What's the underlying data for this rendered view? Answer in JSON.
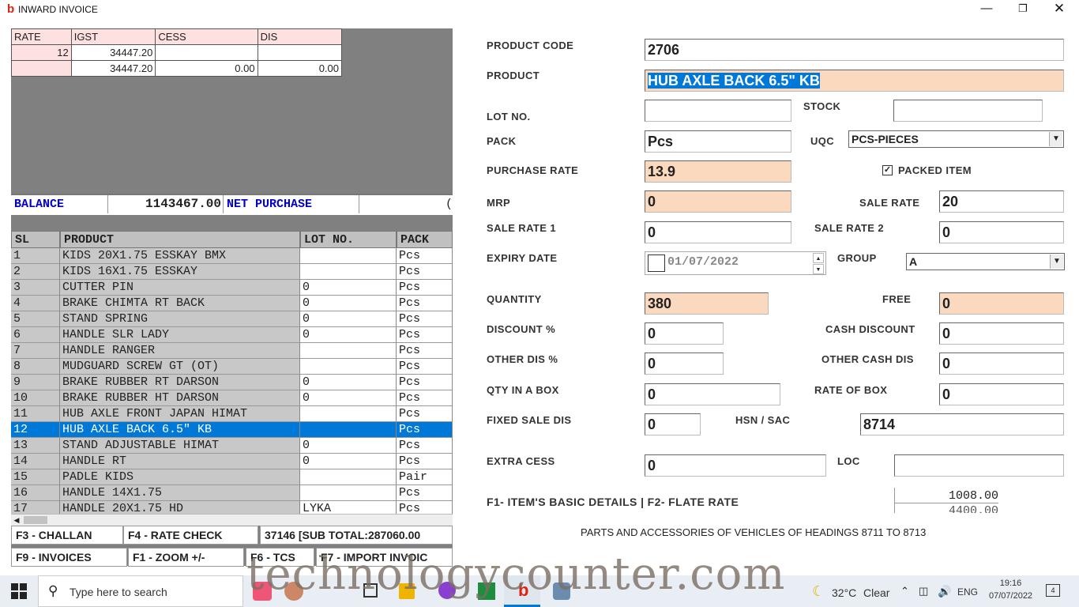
{
  "window": {
    "title": "INWARD INVOICE",
    "app_icon": "b",
    "min_icon": "minimize-icon",
    "max_icon": "maximize-icon",
    "close_icon": "close-icon"
  },
  "summary": {
    "headers": [
      "RATE",
      "IGST",
      "CESS",
      "DIS"
    ],
    "rows": [
      [
        "12",
        "34447.20",
        "",
        ""
      ],
      [
        "",
        "34447.20",
        "0.00",
        "0.00"
      ]
    ]
  },
  "balance": {
    "label": "BALANCE",
    "value": "1143467.00",
    "net_label": "NET PURCHASE",
    "net_value": "("
  },
  "grid": {
    "headers": [
      "SL",
      "PRODUCT",
      "LOT NO.",
      "PACK"
    ],
    "rows": [
      [
        "1",
        "KIDS 20X1.75 ESSKAY BMX",
        "",
        "Pcs"
      ],
      [
        "2",
        "KIDS 16X1.75 ESSKAY",
        "",
        "Pcs"
      ],
      [
        "3",
        "CUTTER PIN",
        "0",
        "Pcs"
      ],
      [
        "4",
        "BRAKE CHIMTA RT BACK",
        "0",
        "Pcs"
      ],
      [
        "5",
        "STAND SPRING",
        "0",
        "Pcs"
      ],
      [
        "6",
        "HANDLE SLR LADY",
        "0",
        "Pcs"
      ],
      [
        "7",
        "HANDLE RANGER",
        "",
        "Pcs"
      ],
      [
        "8",
        "MUDGUARD SCREW GT (OT)",
        "",
        "Pcs"
      ],
      [
        "9",
        "BRAKE RUBBER RT DARSON",
        "0",
        "Pcs"
      ],
      [
        "10",
        "BRAKE RUBBER HT DARSON",
        "0",
        "Pcs"
      ],
      [
        "11",
        "HUB AXLE FRONT JAPAN HIMAT",
        "",
        "Pcs"
      ],
      [
        "12",
        "HUB AXLE BACK 6.5\" KB",
        "",
        "Pcs"
      ],
      [
        "13",
        "STAND ADJUSTABLE HIMAT",
        "0",
        "Pcs"
      ],
      [
        "14",
        "HANDLE RT",
        "0",
        "Pcs"
      ],
      [
        "15",
        "PADLE KIDS",
        "",
        "Pair"
      ],
      [
        "16",
        "HANDLE 14X1.75",
        "",
        "Pcs"
      ],
      [
        "17",
        "HANDLE 20X1.75 HD",
        "LYKA",
        "Pcs"
      ]
    ],
    "selected_row": 11
  },
  "fkeys": {
    "challan": "F3 - CHALLAN",
    "rate_check": "F4 - RATE CHECK",
    "subtotal": "37146 [SUB TOTAL:287060.00",
    "invoices": "F9 - INVOICES",
    "zoom": "F1 - ZOOM +/-",
    "tcs": "F6 - TCS",
    "import": "F7 - IMPORT INVOIC"
  },
  "form": {
    "product_code_label": "PRODUCT CODE",
    "product_code": "2706",
    "product_label": "PRODUCT",
    "product": "HUB AXLE BACK 6.5\" KB",
    "lot_label": "LOT NO.",
    "lot": "",
    "stock_label": "STOCK",
    "stock": "",
    "pack_label": "PACK",
    "pack": "Pcs",
    "uqc_label": "UQC",
    "uqc": "PCS-PIECES",
    "purchase_rate_label": "PURCHASE RATE",
    "purchase_rate": "13.9",
    "packed_item_label": "PACKED ITEM",
    "packed_item_checked": true,
    "mrp_label": "MRP",
    "mrp": "0",
    "sale_rate_label": "SALE RATE",
    "sale_rate": "20",
    "sale_rate1_label": "SALE RATE 1",
    "sale_rate1": "0",
    "sale_rate2_label": "SALE RATE 2",
    "sale_rate2": "0",
    "expiry_label": "EXPIRY DATE",
    "expiry": "01/07/2022",
    "group_label": "GROUP",
    "group": "A",
    "quantity_label": "QUANTITY",
    "quantity": "380",
    "free_label": "FREE",
    "free": "0",
    "discount_label": "DISCOUNT %",
    "discount": "0",
    "cash_discount_label": "CASH DISCOUNT",
    "cash_discount": "0",
    "other_dis_label": "OTHER DIS %",
    "other_dis": "0",
    "other_cash_dis_label": "OTHER CASH DIS",
    "other_cash_dis": "0",
    "qty_box_label": "QTY IN A BOX",
    "qty_box": "0",
    "rate_box_label": "RATE OF BOX",
    "rate_box": "0",
    "fixed_sale_dis_label": "FIXED SALE DIS",
    "fixed_sale_dis": "0",
    "hsn_label": "HSN / SAC",
    "hsn": "8714",
    "extra_cess_label": "EXTRA CESS",
    "extra_cess": "0",
    "loc_label": "LOC",
    "loc": "",
    "help_text": "F1- ITEM'S BASIC DETAILS | F2- FLATE RATE",
    "mini_values": [
      "1008.00",
      "4400.00"
    ],
    "hsn_description": "PARTS AND ACCESSORIES OF VEHICLES OF HEADINGS 8711 TO 8713"
  },
  "taskbar": {
    "search_placeholder": "Type here to search",
    "temp": "32°C",
    "weather": "Clear",
    "lang": "ENG",
    "time": "19:16",
    "date": "07/07/2022",
    "notifications": "4"
  },
  "watermark": "technologycounter.com"
}
